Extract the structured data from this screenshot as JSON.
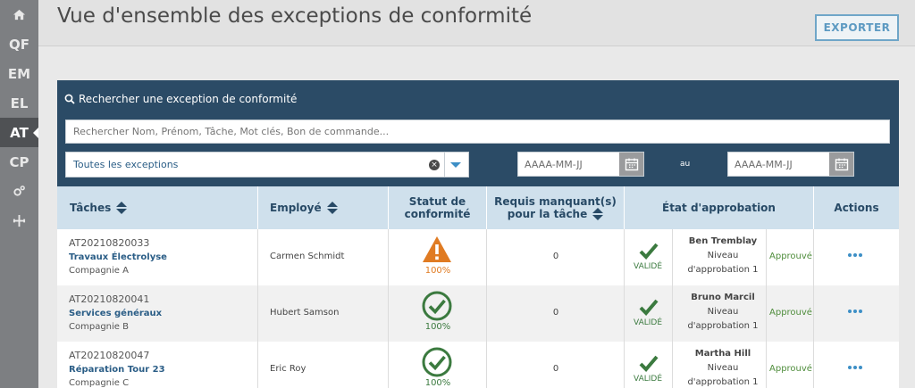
{
  "sidebar": {
    "items": [
      {
        "label": "",
        "icon": "home-icon"
      },
      {
        "label": "QF"
      },
      {
        "label": "EM"
      },
      {
        "label": "EL"
      },
      {
        "label": "AT",
        "active": true
      },
      {
        "label": "CP"
      },
      {
        "label": "",
        "icon": "gears-icon"
      },
      {
        "label": "",
        "icon": "network-icon"
      }
    ]
  },
  "header": {
    "title": "Vue d'ensemble des exceptions de conformité",
    "export_label": "EXPORTER"
  },
  "search": {
    "title": "Rechercher une exception de conformité",
    "placeholder": "Rechercher Nom, Prénom, Tâche, Mot clés, Bon de commande...",
    "filter_value": "Toutes les exceptions",
    "date_placeholder": "AAAA-MM-JJ",
    "date_to_label": "au"
  },
  "table": {
    "headers": {
      "tasks": "Tâches",
      "employee": "Employé",
      "status_line1": "Statut de",
      "status_line2": "conformité",
      "missing_line1": "Requis manquant(s)",
      "missing_line2": "pour la tâche",
      "approval": "État d'approbation",
      "actions": "Actions"
    },
    "rows": [
      {
        "id": "AT20210820033",
        "task": "Travaux Électrolyse",
        "company": "Compagnie A",
        "employee": "Carmen Schmidt",
        "status": "warning",
        "status_pct": "100%",
        "missing": "0",
        "valid_label": "VALIDÉ",
        "approver": "Ben Tremblay",
        "level_line1": "Niveau",
        "level_line2": "d'approbation 1",
        "approval_status": "Approuvé"
      },
      {
        "id": "AT20210820041",
        "task": "Services généraux",
        "company": "Compagnie B",
        "employee": "Hubert Samson",
        "status": "ok",
        "status_pct": "100%",
        "missing": "0",
        "valid_label": "VALIDÉ",
        "approver": "Bruno Marcil",
        "level_line1": "Niveau",
        "level_line2": "d'approbation 1",
        "approval_status": "Approuvé"
      },
      {
        "id": "AT20210820047",
        "task": "Réparation Tour 23",
        "company": "Compagnie C",
        "employee": "Eric Roy",
        "status": "ok",
        "status_pct": "100%",
        "missing": "0",
        "valid_label": "VALIDÉ",
        "approver": "Martha Hill",
        "level_line1": "Niveau",
        "level_line2": "d'approbation 1",
        "approval_status": "Approuvé"
      }
    ]
  },
  "colors": {
    "panel": "#2b4b66",
    "header_row": "#cfe0ec",
    "warning": "#e07b22",
    "ok": "#3b7a3f",
    "link": "#2a5d86"
  }
}
